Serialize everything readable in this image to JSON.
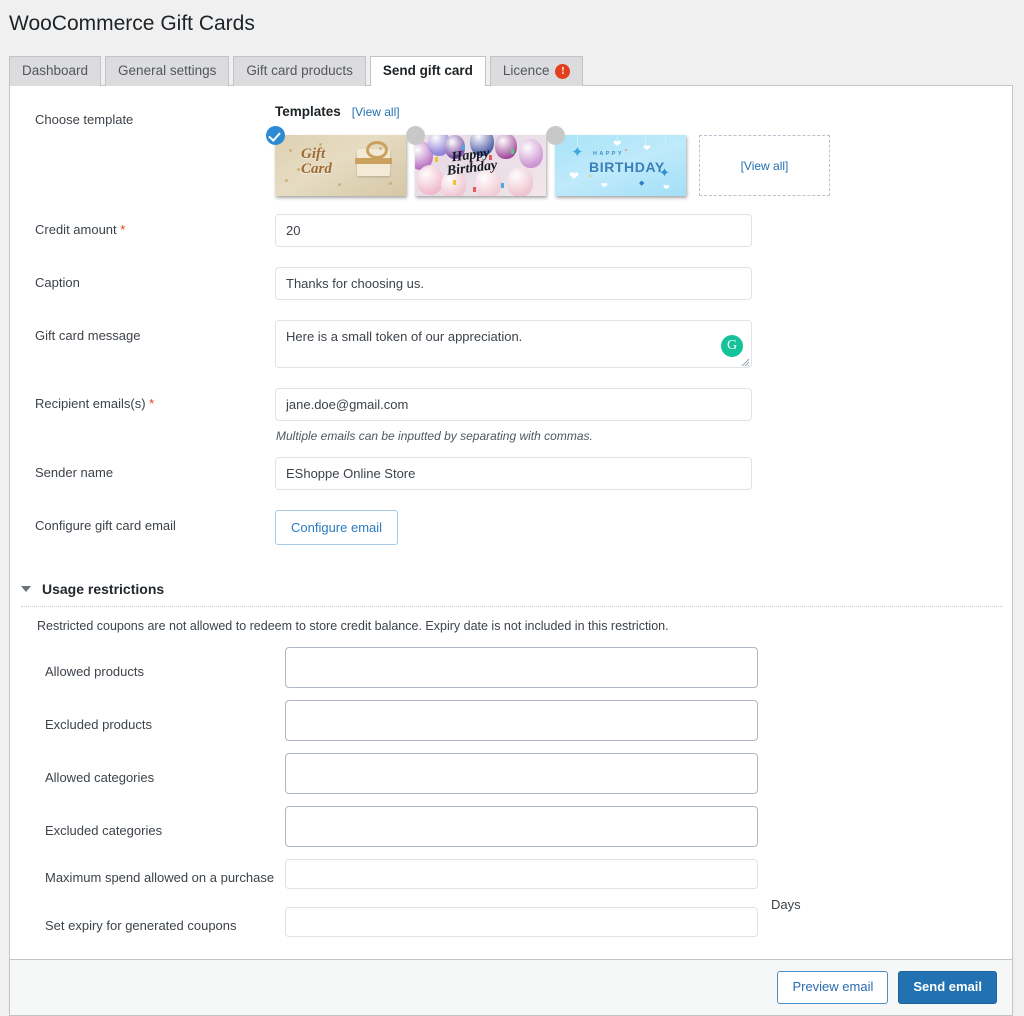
{
  "page": {
    "title": "WooCommerce Gift Cards"
  },
  "tabs": [
    {
      "label": "Dashboard",
      "active": false,
      "icon": null
    },
    {
      "label": "General settings",
      "active": false,
      "icon": null
    },
    {
      "label": "Gift card products",
      "active": false,
      "icon": null
    },
    {
      "label": "Send gift card",
      "active": true,
      "icon": null
    },
    {
      "label": "Licence",
      "active": false,
      "icon": "alert-icon",
      "icon_glyph": "!"
    }
  ],
  "form": {
    "choose_template": {
      "label": "Choose template",
      "templates_heading": "Templates",
      "view_all_link": "[View all]",
      "view_all_box": "[View all]",
      "items": [
        {
          "name": "gift-card-classic",
          "caption": "Gift Card",
          "selected": true
        },
        {
          "name": "happy-birthday-balloons",
          "caption": "Happy Birthday",
          "selected": false
        },
        {
          "name": "happy-birthday-blue",
          "caption": "HAPPY BIRTHDAY",
          "selected": false
        }
      ]
    },
    "credit_amount": {
      "label": "Credit amount",
      "required": true,
      "required_mark": "*",
      "value": "20",
      "placeholder": ""
    },
    "caption": {
      "label": "Caption",
      "required": false,
      "value": "Thanks for choosing us.",
      "placeholder": ""
    },
    "gift_card_message": {
      "label": "Gift card message",
      "required": false,
      "value": "Here is a small token of our appreciation.",
      "placeholder": "",
      "assistant_icon": "grammarly-icon",
      "assistant_glyph": "G"
    },
    "recipient_emails": {
      "label": "Recipient emails(s)",
      "required": true,
      "required_mark": "*",
      "value": "jane.doe@gmail.com",
      "placeholder": "",
      "helper": "Multiple emails can be inputted by separating with commas."
    },
    "sender_name": {
      "label": "Sender name",
      "required": false,
      "value": "EShoppe Online Store",
      "placeholder": ""
    },
    "configure_gift_card_email": {
      "label": "Configure gift card email",
      "button_label": "Configure email"
    }
  },
  "usage_restrictions": {
    "heading": "Usage restrictions",
    "expanded": true,
    "note": "Restricted coupons are not allowed to redeem to store credit balance. Expiry date is not included in this restriction.",
    "fields": [
      {
        "label": "Allowed products",
        "value": "",
        "placeholder": "",
        "kind": "select2"
      },
      {
        "label": "Excluded products",
        "value": "",
        "placeholder": "",
        "kind": "select2"
      },
      {
        "label": "Allowed categories",
        "value": "",
        "placeholder": "",
        "kind": "select2"
      },
      {
        "label": "Excluded categories",
        "value": "",
        "placeholder": "",
        "kind": "select2"
      },
      {
        "label": "Maximum spend allowed on a purchase",
        "value": "",
        "placeholder": "",
        "kind": "input"
      },
      {
        "label": "Set expiry for generated coupons",
        "value": "",
        "placeholder": "",
        "kind": "input",
        "suffix": "Days"
      }
    ]
  },
  "footer": {
    "preview_label": "Preview email",
    "send_label": "Send email"
  },
  "colors": {
    "accent": "#2271b1",
    "link": "#2271b1",
    "alert": "#e2401c",
    "assistant": "#15c39a",
    "selected_badge": "#2d8bd4",
    "page_bg": "#f0f0f1",
    "panel_bg": "#ffffff",
    "footer_bg": "#f6f7f7"
  }
}
